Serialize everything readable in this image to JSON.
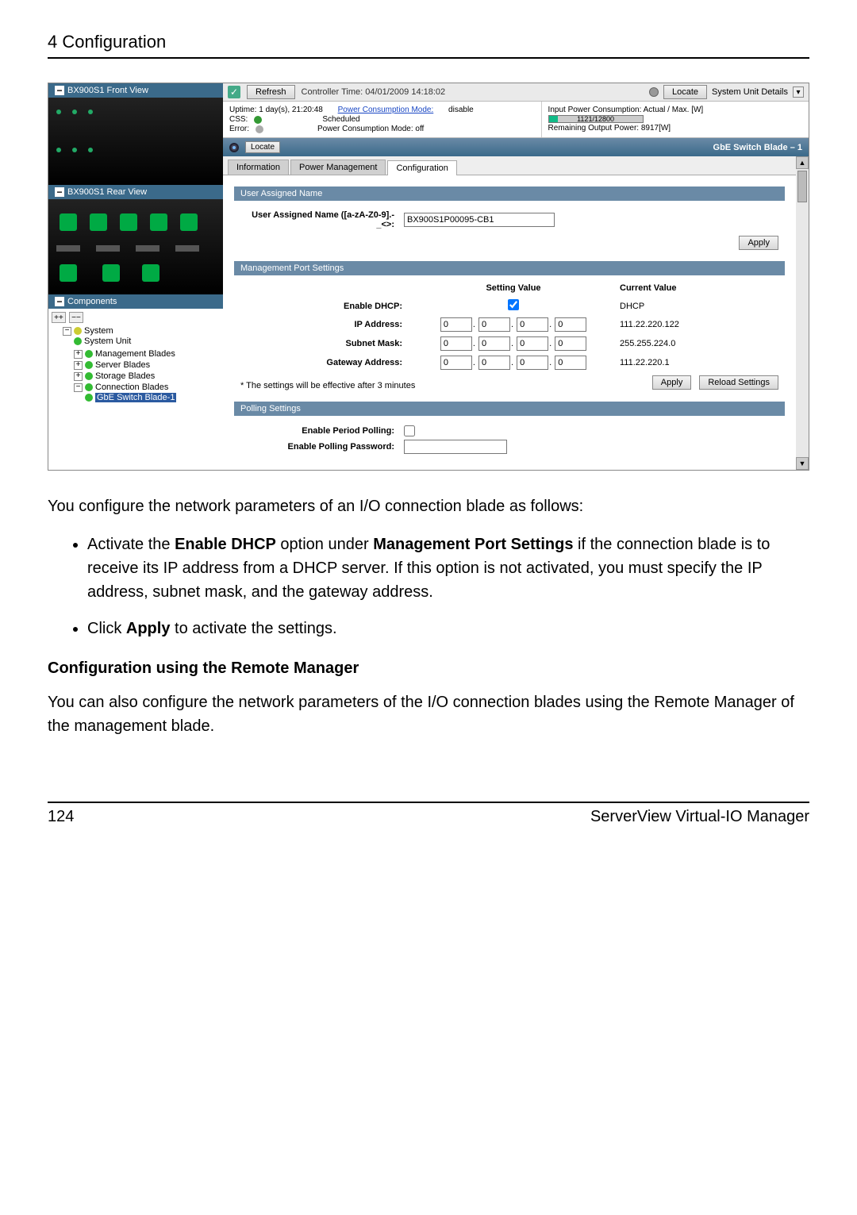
{
  "doc": {
    "header": "4 Configuration",
    "para1": "You configure the network parameters of an I/O connection blade as follows:",
    "bullet1_a": "Activate the ",
    "bullet1_b": "Enable DHCP",
    "bullet1_c": " option under ",
    "bullet1_d": "Management Port Settings",
    "bullet1_e": " if the connection blade is to receive its IP address from a DHCP server. If this option is not activated, you must specify the IP address, subnet mask, and the gateway address.",
    "bullet2_a": "Click ",
    "bullet2_b": "Apply",
    "bullet2_c": " to activate the settings.",
    "subhead": "Configuration using the Remote Manager",
    "para2": "You can also configure the network parameters of the I/O connection blades using the Remote Manager of the management blade.",
    "page": "124",
    "product": "ServerView Virtual-IO Manager"
  },
  "shot": {
    "front_title": "BX900S1 Front View",
    "rear_title": "BX900S1 Rear View",
    "components_title": "Components",
    "tree": {
      "system": "System",
      "system_unit": "System Unit",
      "mgmt_blades": "Management Blades",
      "server_blades": "Server Blades",
      "storage_blades": "Storage Blades",
      "conn_blades": "Connection Blades",
      "gbe1": "GbE Switch Blade-1"
    },
    "top": {
      "refresh": "Refresh",
      "ctrl_time": "Controller Time: 04/01/2009 14:18:02",
      "locate": "Locate",
      "sysdetails": "System Unit Details"
    },
    "info": {
      "uptime": "Uptime: 1 day(s), 21:20:48",
      "pcm_label": "Power Consumption Mode:",
      "pcm_val": "disable",
      "css": "CSS:",
      "scheduled": "Scheduled",
      "error": "Error:",
      "pcm_off": "Power Consumption Mode:  off",
      "input_pc": "Input Power Consumption: Actual / Max. [W]",
      "ratio": "1121/12800",
      "remain": "Remaining Output Power: 8917[W]"
    },
    "switch": {
      "locate": "Locate",
      "title": "GbE Switch Blade – 1"
    },
    "tabs": {
      "info": "Information",
      "power": "Power Management",
      "config": "Configuration"
    },
    "user_assigned": {
      "head": "User Assigned Name",
      "label": "User Assigned Name ([a-zA-Z0-9].-_<>:",
      "value": "BX900S1P00095-CB1",
      "apply": "Apply"
    },
    "mps": {
      "head": "Management Port Settings",
      "setting": "Setting Value",
      "current": "Current Value",
      "enable_dhcp": "Enable DHCP:",
      "ip": "IP Address:",
      "subnet": "Subnet Mask:",
      "gateway": "Gateway Address:",
      "dhcp_cur": "DHCP",
      "ip_cur": "111.22.220.122",
      "subnet_cur": "255.255.224.0",
      "gw_cur": "111.22.220.1",
      "note": "* The settings will be effective after 3 minutes",
      "apply": "Apply",
      "reload": "Reload Settings"
    },
    "polling": {
      "head": "Polling Settings",
      "period": "Enable Period Polling:",
      "pass": "Enable Polling Password:"
    },
    "zero": "0"
  }
}
